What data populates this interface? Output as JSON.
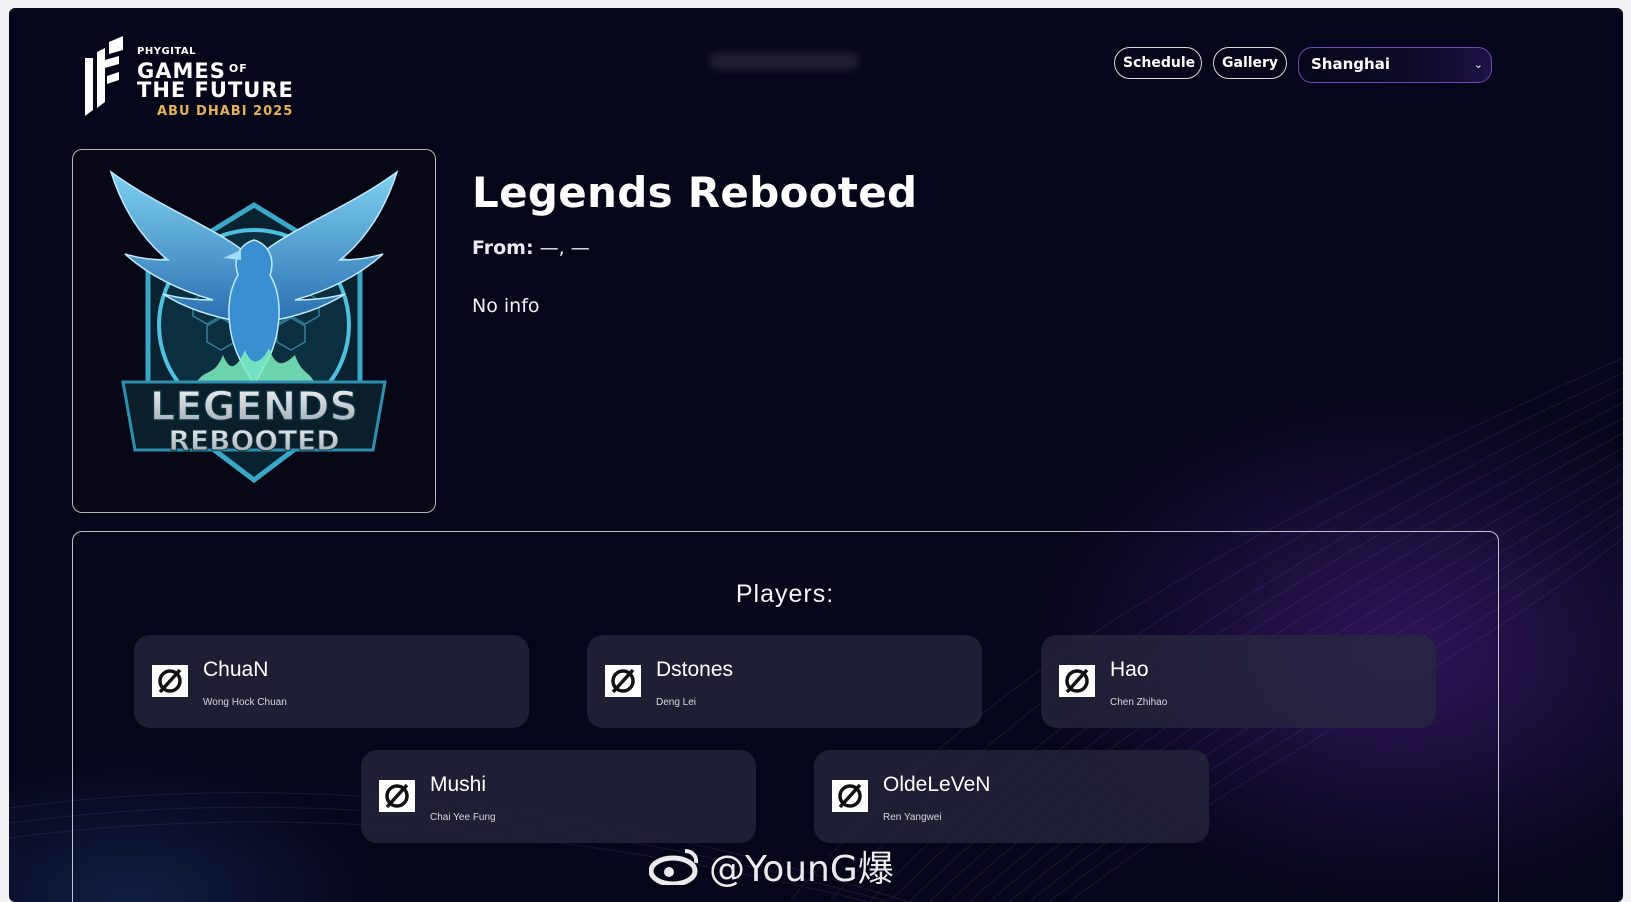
{
  "header": {
    "logo": {
      "small": "PHYGITAL",
      "line1": "GAMES",
      "line1_suffix": "OF",
      "line2": "THE FUTURE",
      "line3": "ABU DHABI 2025"
    },
    "nav": {
      "schedule_label": "Schedule",
      "gallery_label": "Gallery",
      "city_select_value": "Shanghai"
    }
  },
  "team": {
    "name": "Legends Rebooted",
    "from_label": "From:",
    "from_value": "—, —",
    "info": "No info",
    "logo_text_line1": "LEGENDS",
    "logo_text_line2": "REBOOTED"
  },
  "players": {
    "heading": "Players:",
    "list": [
      {
        "nickname": "ChuaN",
        "real_name": "Wong Hock Chuan"
      },
      {
        "nickname": "Dstones",
        "real_name": "Deng Lei"
      },
      {
        "nickname": "Hao",
        "real_name": "Chen Zhihao"
      },
      {
        "nickname": "Mushi",
        "real_name": "Chai Yee Fung"
      },
      {
        "nickname": "OldeLeVeN",
        "real_name": "Ren Yangwei"
      }
    ]
  },
  "watermark": "@YounG爆",
  "colors": {
    "background": "#06061a",
    "accent_gold": "#e5b152",
    "select_border": "#6b4ab8",
    "card_bg": "#28283e"
  }
}
